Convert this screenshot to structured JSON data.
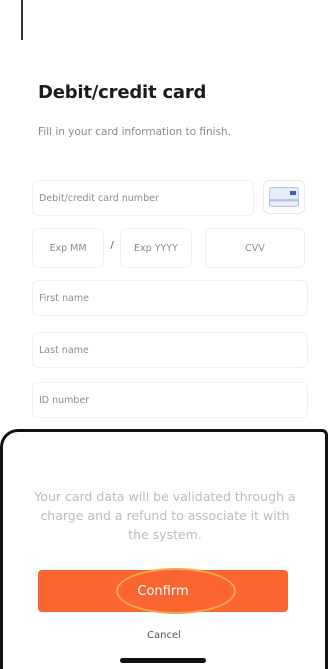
{
  "header": {
    "title": "Debit/credit card",
    "subtitle": "Fill in your card information to finish."
  },
  "form": {
    "card_number_placeholder": "Debit/credit card number",
    "exp_month_placeholder": "Exp MM",
    "separator": "/",
    "exp_year_placeholder": "Exp YYYY",
    "cvv_placeholder": "CVV",
    "first_name_placeholder": "First name",
    "last_name_placeholder": "Last name",
    "id_number_placeholder": "ID number",
    "card_icon": "credit-card-icon"
  },
  "sheet": {
    "message": "Your card data will be validated through a charge and a refund to associate it with the system.",
    "confirm_label": "Confirm",
    "cancel_label": "Cancel"
  },
  "colors": {
    "accent": "#fb6531",
    "highlight": "#f7a64a",
    "card_icon_blue": "#4a7fe0"
  }
}
